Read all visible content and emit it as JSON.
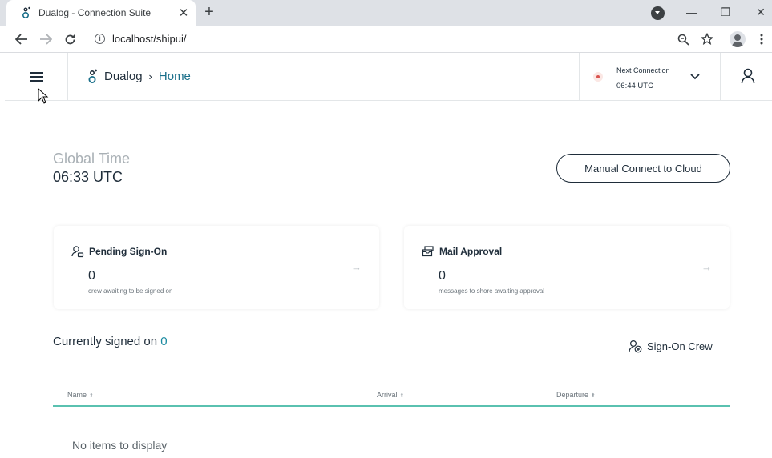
{
  "browser": {
    "tab_title": "Dualog - Connection Suite",
    "tab_close": "✕",
    "new_tab": "+",
    "url": "localhost/shipui/",
    "window_buttons": [
      "—",
      "❐",
      "✕"
    ]
  },
  "header": {
    "brand": "Dualog",
    "separator": "›",
    "page": "Home",
    "next_connection_label": "Next Connection",
    "next_connection_time": "06:44 UTC"
  },
  "main": {
    "global_time_label": "Global Time",
    "global_time_value": "06:33 UTC",
    "manual_connect_label": "Manual Connect to Cloud"
  },
  "cards": [
    {
      "title": "Pending Sign-On",
      "count": "0",
      "subtitle": "crew awaiting to be signed on",
      "icon": "user-pending-icon"
    },
    {
      "title": "Mail Approval",
      "count": "0",
      "subtitle": "messages to shore awaiting approval",
      "icon": "mail-stack-icon"
    }
  ],
  "crew": {
    "title": "Currently signed on",
    "count": "0",
    "sign_on_label": "Sign-On Crew",
    "columns": [
      "Name",
      "Arrival",
      "Departure"
    ],
    "empty_text": "No items to display"
  },
  "colors": {
    "primary": "#1f2d3a",
    "accent": "#1a6f8a",
    "table_rule": "#5ac1b0",
    "status_dot": "#d9534f"
  }
}
